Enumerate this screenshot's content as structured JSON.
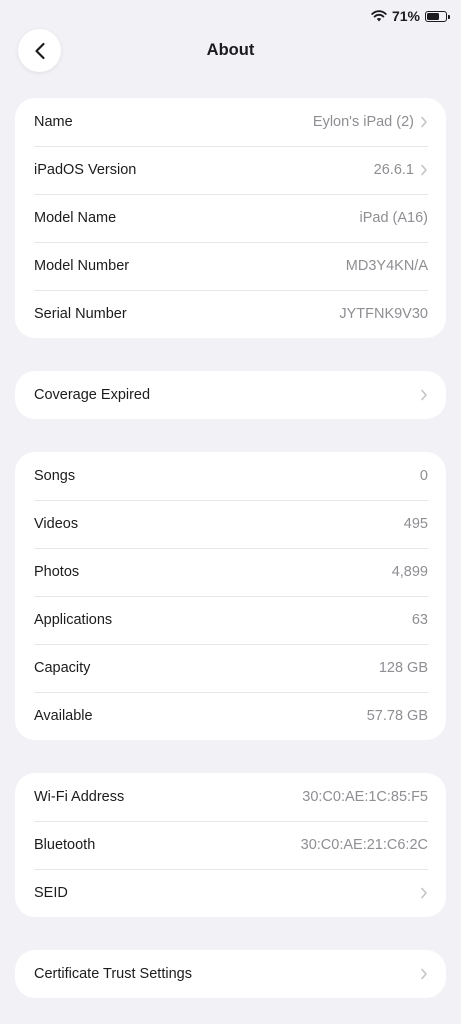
{
  "status": {
    "battery_text": "71%",
    "battery_level": 0.71
  },
  "header": {
    "title": "About"
  },
  "groups": [
    {
      "rows": [
        {
          "label": "Name",
          "value": "Eylon's iPad (2)",
          "chevron": true
        },
        {
          "label": "iPadOS Version",
          "value": "26.6.1",
          "chevron": true
        },
        {
          "label": "Model Name",
          "value": "iPad (A16)",
          "chevron": false
        },
        {
          "label": "Model Number",
          "value": "MD3Y4KN/A",
          "chevron": false
        },
        {
          "label": "Serial Number",
          "value": "JYTFNK9V30",
          "chevron": false
        }
      ]
    },
    {
      "rows": [
        {
          "label": "Coverage Expired",
          "value": "",
          "chevron": true
        }
      ]
    },
    {
      "rows": [
        {
          "label": "Songs",
          "value": "0",
          "chevron": false
        },
        {
          "label": "Videos",
          "value": "495",
          "chevron": false
        },
        {
          "label": "Photos",
          "value": "4,899",
          "chevron": false
        },
        {
          "label": "Applications",
          "value": "63",
          "chevron": false
        },
        {
          "label": "Capacity",
          "value": "128 GB",
          "chevron": false
        },
        {
          "label": "Available",
          "value": "57.78 GB",
          "chevron": false
        }
      ]
    },
    {
      "rows": [
        {
          "label": "Wi-Fi Address",
          "value": "30:C0:AE:1C:85:F5",
          "chevron": false
        },
        {
          "label": "Bluetooth",
          "value": "30:C0:AE:21:C6:2C",
          "chevron": false
        },
        {
          "label": "SEID",
          "value": "",
          "chevron": true
        }
      ]
    },
    {
      "rows": [
        {
          "label": "Certificate Trust Settings",
          "value": "",
          "chevron": true
        }
      ]
    }
  ]
}
